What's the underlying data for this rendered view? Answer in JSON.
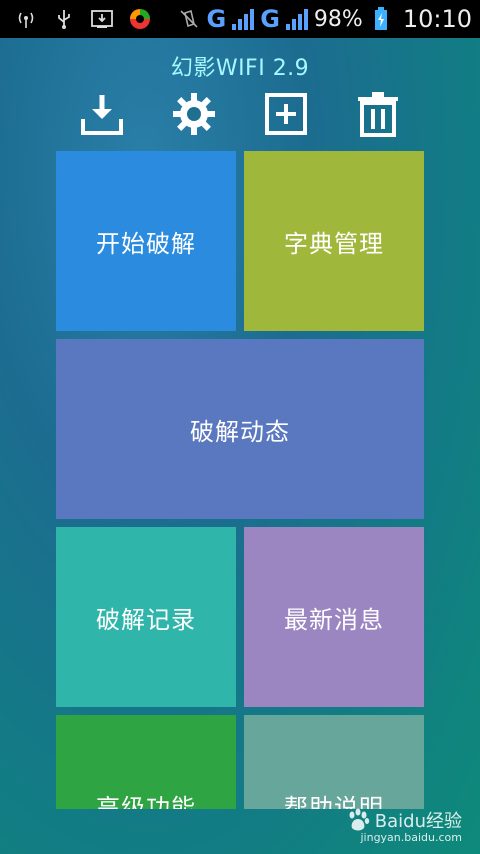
{
  "status_bar": {
    "network_1": "G",
    "network_2": "G",
    "battery_percent": "98%",
    "time": "10:10",
    "icons": [
      "wifi-antenna-icon",
      "usb-icon",
      "download-notif-icon",
      "app-notif-icon",
      "vibrate-off-icon",
      "signal-icon",
      "battery-icon"
    ]
  },
  "app": {
    "title": "幻影WIFI 2.9"
  },
  "toolbar": {
    "icons": [
      "download-icon",
      "settings-gear-icon",
      "add-icon",
      "delete-icon"
    ]
  },
  "tiles": {
    "start_crack": "开始破解",
    "dict_manage": "字典管理",
    "crack_dynamic": "破解动态",
    "crack_records": "破解记录",
    "latest_news": "最新消息",
    "advanced": "高级功能",
    "help": "帮助说明"
  },
  "tile_colors": {
    "start_crack": "#2b8cdf",
    "dict_manage": "#9fb83c",
    "crack_dynamic": "#5a78bf",
    "crack_records": "#2fb5aa",
    "latest_news": "#9b86c2",
    "advanced": "#2ea442",
    "help": "#67a69a"
  },
  "watermark": {
    "top": "Baidu经验",
    "bottom": "jingyan.baidu.com"
  }
}
